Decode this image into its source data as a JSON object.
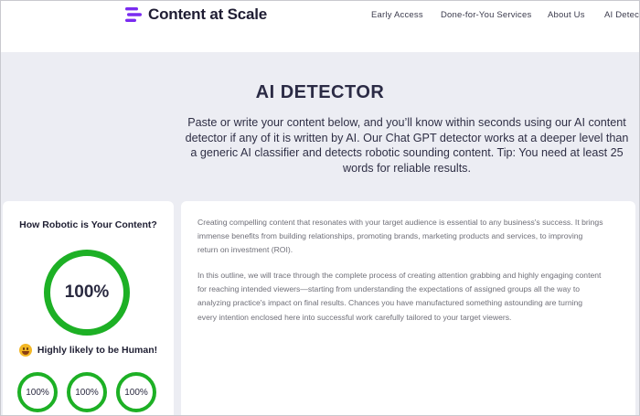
{
  "brand": {
    "name": "Content at Scale",
    "accent": "#7a2bf0"
  },
  "nav": {
    "items": [
      {
        "label": "Early Access"
      },
      {
        "label": "Done-for-You Services"
      },
      {
        "label": "About Us"
      },
      {
        "label": "AI Detect"
      }
    ]
  },
  "hero": {
    "title": "AI DETECTOR",
    "description": "Paste or write your content below, and you’ll know within seconds using our AI content detector if any of it is written by AI. Our Chat GPT detector works at a deeper level than a generic AI classifier and detects robotic sounding content. Tip: You need at least 25 words for reliable results."
  },
  "score_panel": {
    "title": "How Robotic is Your Content?",
    "score": "100%",
    "verdict": "Highly likely to be Human!",
    "verdict_icon": "grinning-face-icon",
    "sub_scores": [
      "100%",
      "100%",
      "100%"
    ],
    "ring_color": "#1db025"
  },
  "content": {
    "paragraphs": [
      "Creating compelling content that resonates with your target audience is essential to any business's success. It brings immense benefits from building relationships, promoting brands, marketing products and services, to improving return on investment (ROI).",
      "In this outline, we will trace through the complete process of creating attention grabbing and highly engaging content for reaching intended viewers—starting from understanding the expectations of assigned groups all the way to analyzing practice's impact on final results. Chances you have manufactured something astounding are turning every intention enclosed here into successful work carefully tailored to your target viewers."
    ]
  }
}
